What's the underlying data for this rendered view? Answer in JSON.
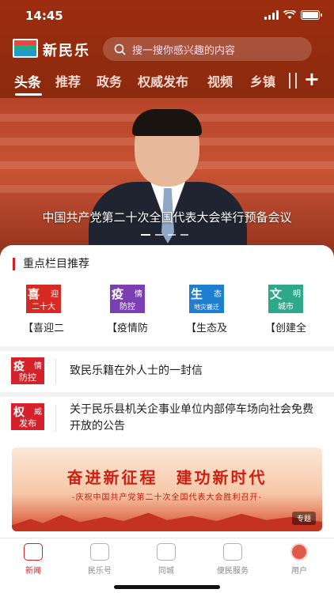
{
  "status_bar": {
    "time": "14:45"
  },
  "app": {
    "name": "新民乐",
    "search_placeholder": "搜一搜你感兴趣的内容"
  },
  "tabs": [
    {
      "label": "头条",
      "active": true
    },
    {
      "label": "推荐"
    },
    {
      "label": "政务"
    },
    {
      "label": "权威发布"
    },
    {
      "label": "视频"
    },
    {
      "label": "乡镇"
    }
  ],
  "hero": {
    "caption": "中国共产党第二十次全国代表大会举行预备会议"
  },
  "featured": {
    "title": "重点栏目推荐",
    "items": [
      {
        "label": "【喜迎二",
        "icon": "xiying-icon",
        "icon_big": "喜",
        "icon_small": "迎",
        "icon_bottom": "二十大"
      },
      {
        "label": "【疫情防",
        "icon": "yiqing-icon",
        "icon_big": "疫",
        "icon_small": "情",
        "icon_bottom": "防控"
      },
      {
        "label": "【生态及",
        "icon": "shengtai-icon",
        "icon_big": "生",
        "icon_small": "态",
        "icon_bottom": "地灾搬迁"
      },
      {
        "label": "【创建全",
        "icon": "wenming-icon",
        "icon_big": "文",
        "icon_small": "明",
        "icon_bottom": "城市"
      }
    ]
  },
  "news": [
    {
      "badge_big": "疫",
      "badge_small": "情",
      "badge_bottom": "防控",
      "title": "致民乐籍在外人士的一封信"
    },
    {
      "badge_big": "权",
      "badge_small": "威",
      "badge_bottom": "发布",
      "title": "关于民乐县机关企事业单位内部停车场向社会免费开放的公告"
    }
  ],
  "promo": {
    "headline": "奋进新征程　建功新时代",
    "subline": "-庆祝中国共产党第二十次全国代表大会胜利召开-",
    "tag": "专题"
  },
  "bottom_nav": [
    {
      "label": "新闻",
      "active": true
    },
    {
      "label": "民乐号"
    },
    {
      "label": "同城"
    },
    {
      "label": "便民服务"
    },
    {
      "label": "用户"
    }
  ],
  "colors": {
    "brand_red": "#d5222a",
    "header_bg": "#9d2d0e"
  }
}
